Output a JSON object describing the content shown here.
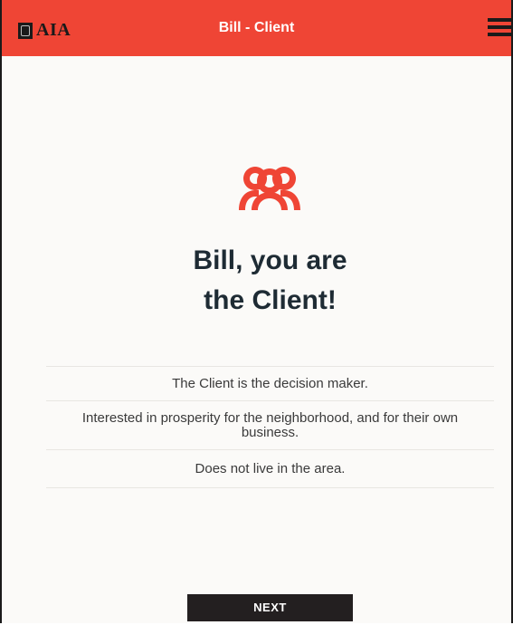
{
  "header": {
    "logo_text": "AIA",
    "title": "Bill - Client",
    "menu_icon": "hamburger-menu-icon"
  },
  "main": {
    "role_icon": "people-icon",
    "heading_line1": "Bill, you are",
    "heading_line2": "the Client!",
    "traits": [
      "The Client is the decision maker.",
      "Interested in prosperity for the neighborhood, and for their own business.",
      "Does not live in the area."
    ],
    "next_label": "NEXT"
  },
  "colors": {
    "accent": "#ef4535",
    "text_dark": "#1e2b34",
    "button_bg": "#231f20",
    "background": "#fbfaf8"
  }
}
